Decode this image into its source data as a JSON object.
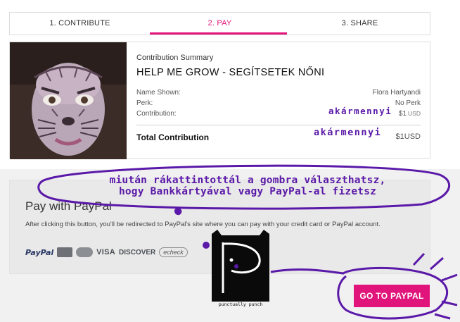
{
  "steps": [
    {
      "label": "1. CONTRIBUTE",
      "active": false
    },
    {
      "label": "2. PAY",
      "active": true
    },
    {
      "label": "3. SHARE",
      "active": false
    }
  ],
  "summary": {
    "heading": "Contribution Summary",
    "campaign_title": "HELP ME GROW - SEGÍTSETEK NŐNI",
    "name_shown_label": "Name Shown:",
    "name_shown_value": "Flora Hartyandi",
    "perk_label": "Perk:",
    "perk_value": "No Perk",
    "contribution_label": "Contribution:",
    "contribution_value": "$1",
    "contribution_currency": "USD",
    "total_label": "Total Contribution",
    "total_value": "$1",
    "total_currency": "USD"
  },
  "paypal": {
    "title": "Pay with PayPal",
    "description": "After clicking this button, you'll be redirected to PayPal's site where you can pay with your credit card or PayPal account.",
    "logos": {
      "paypal": "PayPal",
      "visa": "VISA",
      "discover": "DISCOVER",
      "echeck": "echeck"
    },
    "button_label": "GO TO PAYPAL"
  },
  "annotations": {
    "amount_note_1": "akármennyi",
    "amount_note_2": "akármennyi",
    "instruction_line_1": "miután rákattintottál a gombra választhatsz,",
    "instruction_line_2": "hogy Bankkártyával vagy PayPal-al fizetsz",
    "sticker_caption": "punctually punch"
  },
  "colors": {
    "accent": "#e0147a",
    "annotation": "#5a19a8",
    "panel_bg": "#e9e9e9"
  }
}
